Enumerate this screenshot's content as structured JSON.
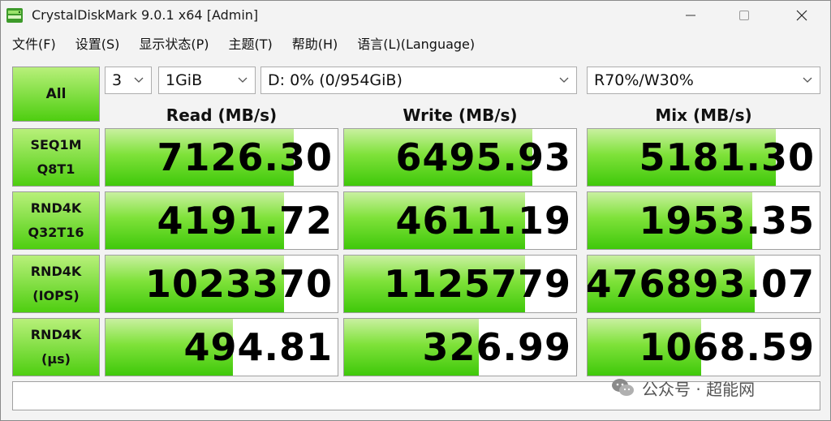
{
  "window": {
    "title": "CrystalDiskMark 9.0.1 x64 [Admin]"
  },
  "menu": [
    {
      "label": "文件(F)"
    },
    {
      "label": "设置(S)"
    },
    {
      "label": "显示状态(P)"
    },
    {
      "label": "主题(T)"
    },
    {
      "label": "帮助(H)"
    },
    {
      "label": "语言(L)(Language)"
    }
  ],
  "controls": {
    "all_label": "All",
    "test_count": "3",
    "test_size": "1GiB",
    "drive": "D: 0% (0/954GiB)",
    "mix_ratio": "R70%/W30%"
  },
  "headers": {
    "read": "Read (MB/s)",
    "write": "Write (MB/s)",
    "mix": "Mix (MB/s)"
  },
  "rows": [
    {
      "line1": "SEQ1M",
      "line2": "Q8T1",
      "read": "7126.30",
      "write": "6495.93",
      "mix": "5181.30",
      "read_fill": 0.81,
      "write_fill": 0.81,
      "mix_fill": 0.81
    },
    {
      "line1": "RND4K",
      "line2": "Q32T16",
      "read": "4191.72",
      "write": "4611.19",
      "mix": "1953.35",
      "read_fill": 0.77,
      "write_fill": 0.78,
      "mix_fill": 0.71
    },
    {
      "line1": "RND4K",
      "line2": "(IOPS)",
      "read": "1023370",
      "write": "1125779",
      "mix": "476893.07",
      "read_fill": 0.77,
      "write_fill": 0.78,
      "mix_fill": 0.72
    },
    {
      "line1": "RND4K",
      "line2": "(µs)",
      "read": "494.81",
      "write": "326.99",
      "mix": "1068.59",
      "read_fill": 0.55,
      "write_fill": 0.58,
      "mix_fill": 0.49
    }
  ],
  "comment": "",
  "watermark": "公众号 · 超能网",
  "colors": {
    "bar_green": "#4ece10",
    "bar_light": "#c9f0a0"
  }
}
